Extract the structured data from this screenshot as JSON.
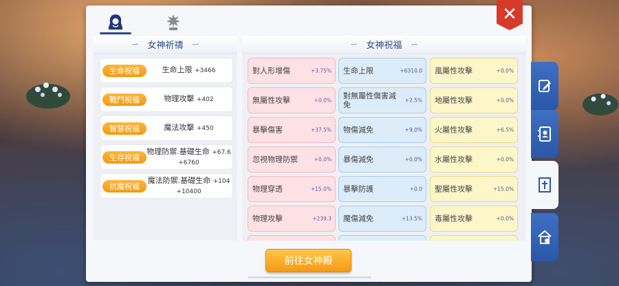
{
  "top_tabs": [
    {
      "icon": "goddess-portrait-icon",
      "active": true
    },
    {
      "icon": "goddess-statue-icon",
      "active": false
    }
  ],
  "close_label": "✕",
  "left_section": {
    "title": "女神祈禱",
    "blessings": [
      {
        "tag": "生命祝福",
        "stat": "生命上限",
        "value": "+3466",
        "value2": ""
      },
      {
        "tag": "戰鬥祝福",
        "stat": "物理攻擊",
        "value": "+402",
        "value2": ""
      },
      {
        "tag": "智慧祝福",
        "stat": "魔法攻擊",
        "value": "+450",
        "value2": ""
      },
      {
        "tag": "生存祝福",
        "stat": "物理防禦.基礎生命",
        "value": "+67.6",
        "value2": "+6760"
      },
      {
        "tag": "抗魔祝福",
        "stat": "魔法防禦.基礎生命",
        "value": "+104",
        "value2": "+10400"
      }
    ]
  },
  "right_section": {
    "title": "女神祝福",
    "grid": [
      [
        {
          "label": "對人形增傷",
          "value": "+3.75%"
        },
        {
          "label": "生命上限",
          "value": "+6310.0"
        },
        {
          "label": "風屬性攻擊",
          "value": "+0.0%"
        }
      ],
      [
        {
          "label": "無屬性攻擊",
          "value": "+0.0%"
        },
        {
          "label": "對無屬性傷害減免",
          "value": "+2.5%"
        },
        {
          "label": "地屬性攻擊",
          "value": "+0.0%"
        }
      ],
      [
        {
          "label": "暴擊傷害",
          "value": "+37.5%"
        },
        {
          "label": "物傷減免",
          "value": "+9.0%"
        },
        {
          "label": "火屬性攻擊",
          "value": "+6.5%"
        }
      ],
      [
        {
          "label": "忽視物理防禦",
          "value": "+0.0%"
        },
        {
          "label": "暴傷減免",
          "value": "+0.0%"
        },
        {
          "label": "水屬性攻擊",
          "value": "+0.0%"
        }
      ],
      [
        {
          "label": "物理穿透",
          "value": "+15.0%"
        },
        {
          "label": "暴擊防護",
          "value": "+0.0"
        },
        {
          "label": "聖屬性攻擊",
          "value": "+15.0%"
        }
      ],
      [
        {
          "label": "物理攻擊",
          "value": "+239.3"
        },
        {
          "label": "魔傷減免",
          "value": "+13.5%"
        },
        {
          "label": "毒屬性攻擊",
          "value": "+0.0%"
        }
      ]
    ]
  },
  "goto_button": "前往女神殿",
  "side_tabs": [
    {
      "icon": "edit-note-icon",
      "active": false
    },
    {
      "icon": "contact-book-icon",
      "active": false
    },
    {
      "icon": "goddess-shrine-icon",
      "active": true
    },
    {
      "icon": "guild-house-icon",
      "active": false
    }
  ]
}
